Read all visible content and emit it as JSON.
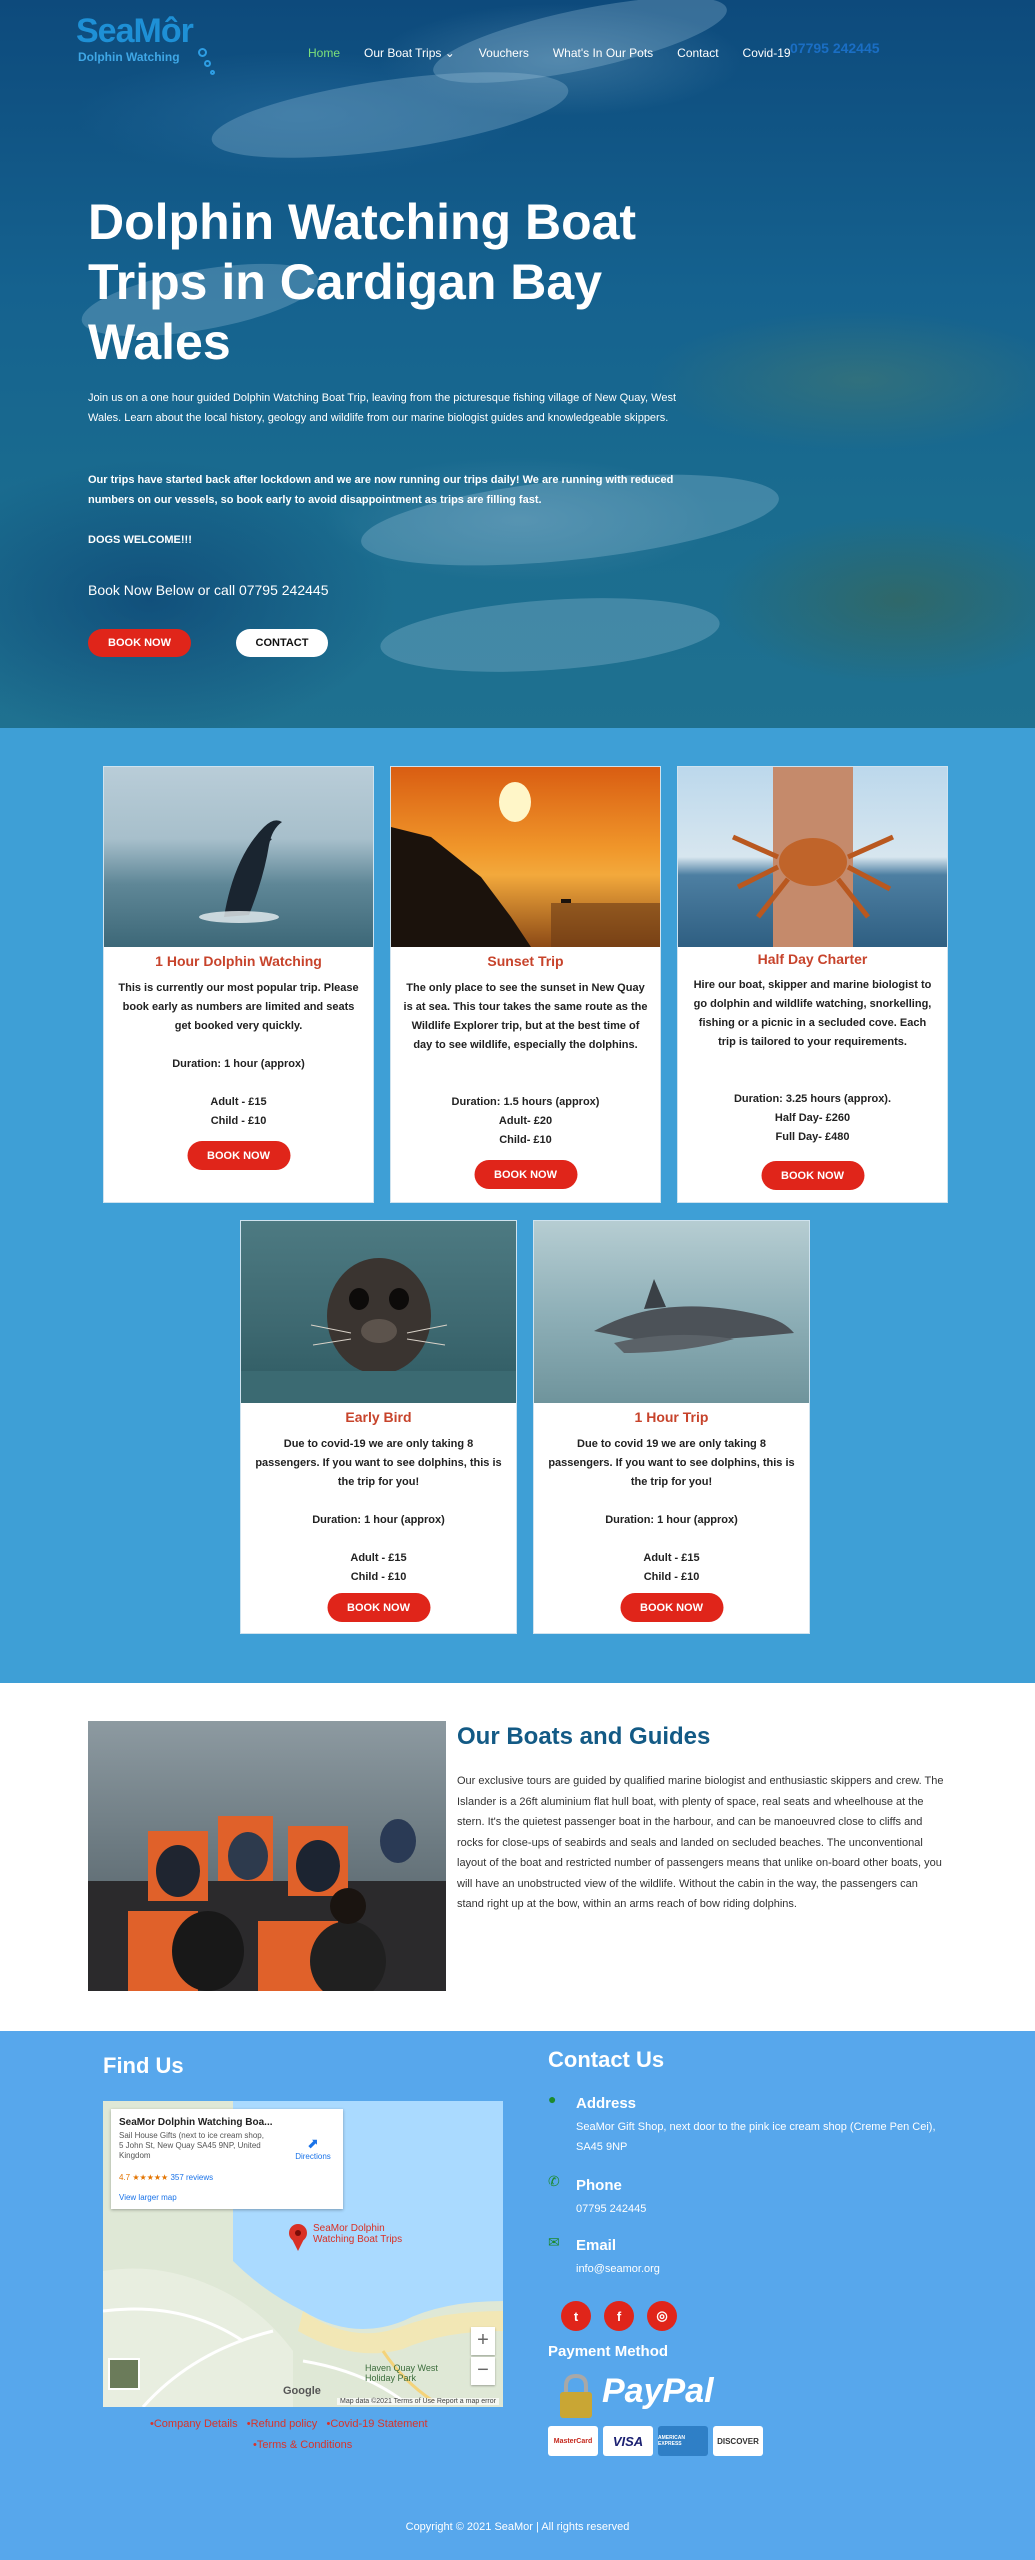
{
  "header": {
    "logo_text": "SeaMôr",
    "logo_subtitle": "Dolphin Watching",
    "nav": [
      "Home",
      "Our Boat Trips",
      "Vouchers",
      "What's In Our Pots",
      "Contact",
      "Covid-19"
    ],
    "phone": "07795 242445"
  },
  "hero": {
    "title": "Dolphin Watching Boat Trips in Cardigan Bay Wales",
    "intro": "Join us on a one hour guided Dolphin Watching Boat Trip, leaving from the picturesque fishing village of New Quay, West Wales. Learn about the local history, geology and wildlife from our marine biologist guides and knowledgeable skippers.",
    "notice": "Our trips have started back after lockdown and we are now running our trips daily! We are running with reduced numbers on our vessels, so book early to avoid disappointment as trips are filling fast.",
    "dogs": "DOGS WELCOME!!!",
    "call": "Book Now Below or call 07795 242445",
    "book_label": "BOOK NOW",
    "contact_label": "CONTACT"
  },
  "trips": [
    {
      "title": "1 Hour Dolphin Watching",
      "text": "This is currently our most popular trip. Please book early as numbers are limited and seats get booked very quickly.",
      "duration": "Duration: 1 hour (approx)",
      "prices": [
        "Adult - £15",
        "Child - £10"
      ],
      "button": "BOOK NOW"
    },
    {
      "title": "Sunset Trip",
      "text": "The only place to see the sunset in New Quay is at sea. This tour takes the same route as the Wildlife Explorer trip, but at the best time of day to see wildlife, especially the dolphins.",
      "duration": "Duration: 1.5 hours (approx)",
      "prices": [
        "Adult- £20",
        "Child- £10"
      ],
      "button": "BOOK NOW"
    },
    {
      "title": "Half Day Charter",
      "text": "Hire our boat, skipper and marine biologist to go dolphin and wildlife watching, snorkelling, fishing or a picnic in a secluded cove. Each trip is tailored to your requirements.",
      "duration": "Duration: 3.25 hours (approx).",
      "prices": [
        "Half Day- £260",
        "Full Day- £480"
      ],
      "button": "BOOK NOW"
    },
    {
      "title": "Early Bird",
      "text": "Due to covid-19 we are only taking 8 passengers. If you want to see dolphins, this is the trip for you!",
      "duration": "Duration: 1 hour (approx)",
      "prices": [
        "Adult - £15",
        "Child - £10"
      ],
      "button": "BOOK NOW"
    },
    {
      "title": "1 Hour Trip",
      "text": "Due to covid 19 we are only taking 8 passengers. If you want to see dolphins, this is the trip for you!",
      "duration": "Duration: 1 hour (approx)",
      "prices": [
        "Adult - £15",
        "Child - £10"
      ],
      "button": "BOOK NOW"
    }
  ],
  "boats": {
    "title": "Our Boats and Guides",
    "text": "Our exclusive tours are guided by qualified marine biologist and enthusiastic skippers and crew. The Islander is a 26ft aluminium flat hull boat, with plenty of space, real seats and wheelhouse at the stern. It's the quietest passenger boat in the harbour, and can be manoeuvred close to cliffs and rocks for close-ups of seabirds and seals and landed on secluded beaches. The unconventional layout of the boat and restricted number of passengers means that unlike on-board other boats, you will have an unobstructed view of the wildlife. Without the cabin in the way, the passengers can stand right up at the bow, within an arms reach of bow riding dolphins."
  },
  "find": {
    "title": "Find Us",
    "map_card_title": "SeaMor Dolphin Watching Boa...",
    "map_card_address": "Sail House Gifts (next to ice cream shop, 5 John St, New Quay SA45 9NP, United Kingdom",
    "map_rating": "4.7 ★★★★★",
    "map_reviews": "357 reviews",
    "map_larger": "View larger map",
    "map_directions": "Directions",
    "map_pin_label": "SeaMor Dolphin Watching Boat Trips",
    "map_google": "Google",
    "map_attribution": "Map data ©2021   Terms of Use   Report a map error",
    "map_place": "Haven Quay West Holiday Park",
    "links_row1": [
      "Company Details",
      "Refund policy",
      "Covid-19 Statement"
    ],
    "links_row2": [
      "Terms & Conditions"
    ]
  },
  "contact": {
    "title": "Contact Us",
    "address_label": "Address",
    "address": "SeaMor Gift Shop, next door to the pink ice cream shop (Creme Pen Cei), SA45 9NP",
    "phone_label": "Phone",
    "phone": "07795 242445",
    "email_label": "Email",
    "email": "info@seamor.org",
    "social": [
      "twitter",
      "facebook",
      "instagram"
    ],
    "payment_title": "Payment Method",
    "paypal": "PayPal",
    "cards": [
      "MasterCard",
      "VISA",
      "AMERICAN EXPRESS",
      "DISCOVER"
    ]
  },
  "copyright": "Copyright © 2021 SeaMor | All rights reserved",
  "colors": {
    "accent": "#e0251a",
    "trip_bg": "#3e9fd6",
    "footer_bg": "#57a7ec",
    "title_red": "#c7432b",
    "heading_blue": "#135a85"
  }
}
